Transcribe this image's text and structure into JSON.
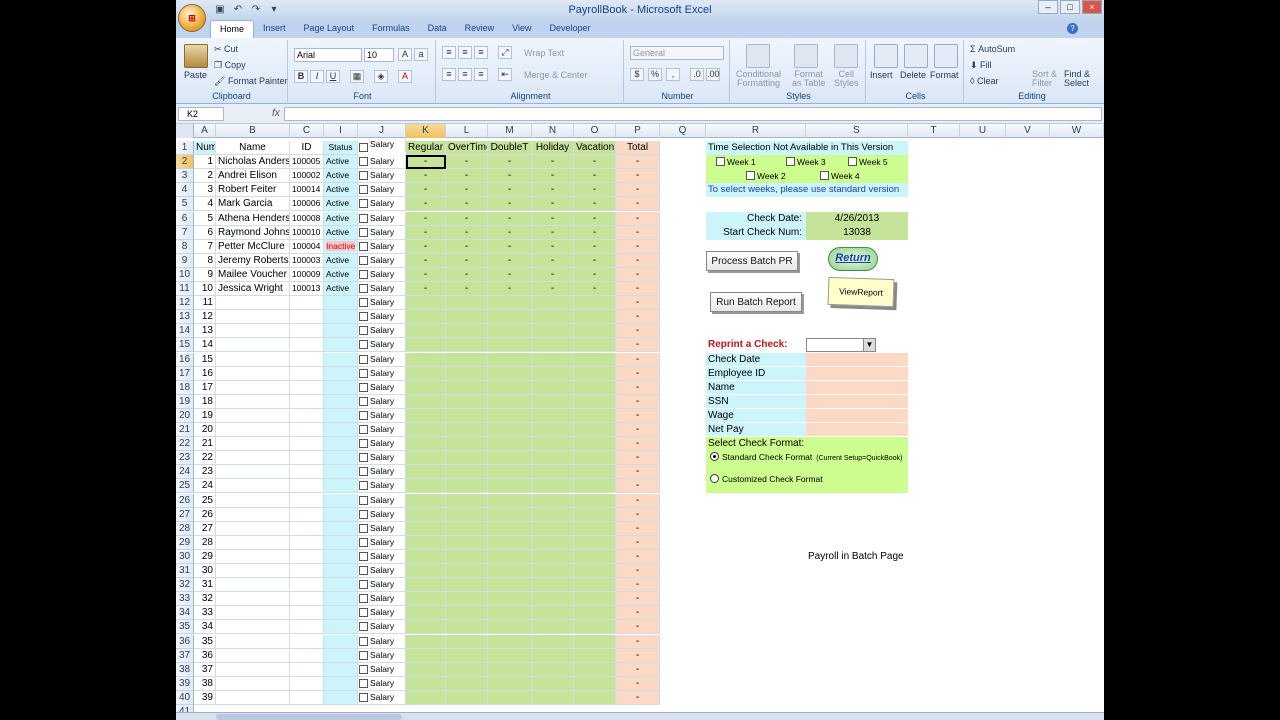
{
  "window": {
    "title": "PayrollBook - Microsoft Excel",
    "office_button": "⊞"
  },
  "ribbon": {
    "tabs": [
      "Home",
      "Insert",
      "Page Layout",
      "Formulas",
      "Data",
      "Review",
      "View",
      "Developer"
    ],
    "active_tab": "Home",
    "clipboard": {
      "paste": "Paste",
      "cut": "Cut",
      "copy": "Copy",
      "format_painter": "Format Painter",
      "label": "Clipboard"
    },
    "font": {
      "name": "Arial",
      "size": "10",
      "bold": "B",
      "italic": "I",
      "underline": "U",
      "label": "Font"
    },
    "alignment": {
      "wrap_text": "Wrap Text",
      "merge_center": "Merge & Center",
      "label": "Alignment"
    },
    "number": {
      "format": "General",
      "currency": "$",
      "percent": "%",
      "comma": ",",
      "label": "Number"
    },
    "styles": {
      "conditional": "Conditional\nFormatting",
      "format_table": "Format\nas Table",
      "cell_styles": "Cell\nStyles",
      "label": "Styles"
    },
    "cells": {
      "insert": "Insert",
      "delete": "Delete",
      "format": "Format",
      "label": "Cells"
    },
    "editing": {
      "autosum": "AutoSum",
      "fill": "Fill",
      "clear": "Clear",
      "sort_filter": "Sort &\nFilter",
      "find_select": "Find &\nSelect",
      "label": "Editing"
    }
  },
  "formula_bar": {
    "name_box": "K2",
    "fx": "fx",
    "value": ""
  },
  "columns": [
    "A",
    "B",
    "C",
    "I",
    "J",
    "K",
    "L",
    "M",
    "N",
    "O",
    "P",
    "Q",
    "R",
    "S",
    "T",
    "U",
    "V",
    "W"
  ],
  "selected_column": "K",
  "headers": {
    "num": "Num",
    "name": "Name",
    "id": "ID",
    "status": "Status",
    "salary": "Salary",
    "regular": "Regular",
    "overtime": "OverTime",
    "doublet": "DoubleT",
    "holiday": "Holiday",
    "vacation": "Vacation",
    "total": "Total"
  },
  "employees": [
    {
      "num": "1",
      "name": "Nicholas Anderson",
      "id": "100005",
      "status": "Active",
      "salary": "Salary"
    },
    {
      "num": "2",
      "name": "Andrei Elison",
      "id": "100002",
      "status": "Active",
      "salary": "Salary"
    },
    {
      "num": "3",
      "name": "Robert Feiter",
      "id": "100014",
      "status": "Active",
      "salary": "Salary"
    },
    {
      "num": "4",
      "name": "Mark Garcia",
      "id": "100006",
      "status": "Active",
      "salary": "Salary"
    },
    {
      "num": "5",
      "name": "Athena Henderson",
      "id": "100008",
      "status": "Active",
      "salary": "Salary"
    },
    {
      "num": "6",
      "name": "Raymond Johnson",
      "id": "100010",
      "status": "Active",
      "salary": "Salary"
    },
    {
      "num": "7",
      "name": "Petter McClure",
      "id": "100004",
      "status": "Inactive",
      "salary": "Salary"
    },
    {
      "num": "8",
      "name": "Jeremy Roberts",
      "id": "100003",
      "status": "Active",
      "salary": "Salary"
    },
    {
      "num": "9",
      "name": "Mailee Voucher",
      "id": "100009",
      "status": "Active",
      "salary": "Salary"
    },
    {
      "num": "10",
      "name": "Jessica Wright",
      "id": "100013",
      "status": "Active",
      "salary": "Salary"
    }
  ],
  "empty_row_nums": [
    "11",
    "12",
    "13",
    "14",
    "15",
    "16",
    "17",
    "18",
    "19",
    "20",
    "21",
    "22",
    "23",
    "24",
    "25",
    "26",
    "27",
    "28",
    "29",
    "30",
    "31",
    "32",
    "33",
    "34",
    "35",
    "36",
    "37",
    "38",
    "39"
  ],
  "dash": "-",
  "salary_label": "Salary",
  "time_selection": {
    "title": "Time Selection Not Available in This Version",
    "weeks": [
      "Week 1",
      "Week 3",
      "Week 5",
      "Week 2",
      "Week 4"
    ],
    "note": "To select weeks,  please use standard version"
  },
  "check": {
    "date_label": "Check Date:",
    "date_value": "4/26/2013",
    "start_label": "Start Check Num:",
    "start_value": "13038"
  },
  "buttons": {
    "process": "Process Batch PR",
    "return": "Return",
    "run_report": "Run Batch Report",
    "view_report": "ViewReport"
  },
  "reprint": {
    "title": "Reprint a Check:",
    "fields": [
      "Check Date",
      "Employee ID",
      "Name",
      "SSN",
      "Wage",
      "Net Pay"
    ],
    "format_title": "Select Check Format:",
    "standard": "Standard Check Format",
    "standard_note": "(Current Setup=QuickBook)",
    "customized": "Customized Check Format"
  },
  "page_note": "Payroll in Batch Page",
  "colors": {
    "cyan": "#ccf4fb",
    "green": "#c6e39a",
    "peach": "#fcd9c4",
    "light_green": "#ccfd8e",
    "inactive": "#f6c6cc"
  }
}
